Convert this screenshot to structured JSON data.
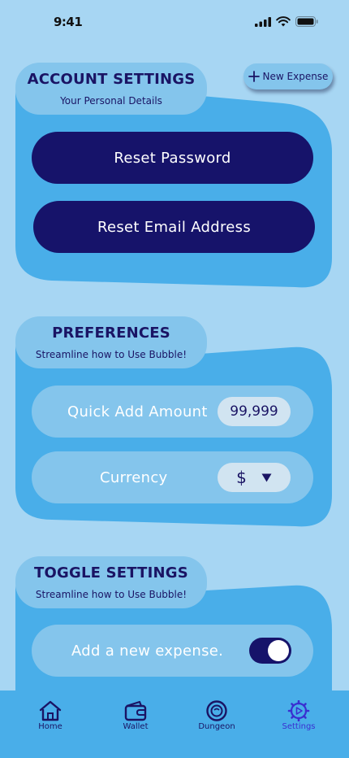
{
  "status": {
    "time": "9:41"
  },
  "header": {
    "new_expense_label": "New Expense"
  },
  "account": {
    "title": "ACCOUNT SETTINGS",
    "subtitle": "Your Personal Details",
    "reset_password": "Reset Password",
    "reset_email": "Reset Email Address"
  },
  "preferences": {
    "title": "PREFERENCES",
    "subtitle": "Streamline how to Use Bubble!",
    "quick_add_label": "Quick Add Amount",
    "quick_add_value": "99,999",
    "currency_label": "Currency",
    "currency_value": "$"
  },
  "toggles": {
    "title": "TOGGLE SETTINGS",
    "subtitle": "Streamline how to Use Bubble!",
    "add_expense_label": "Add a new expense.",
    "add_expense_on": true
  },
  "tabs": [
    {
      "label": "Home",
      "icon": "home-icon"
    },
    {
      "label": "Wallet",
      "icon": "wallet-icon"
    },
    {
      "label": "Dungeon",
      "icon": "dungeon-icon"
    },
    {
      "label": "Settings",
      "icon": "gear-icon",
      "active": true
    }
  ],
  "colors": {
    "background": "#a7d6f3",
    "card": "#49aee9",
    "header_pill": "#84c5ec",
    "dark_button": "#16136a",
    "active_tab": "#3a2fd0"
  }
}
